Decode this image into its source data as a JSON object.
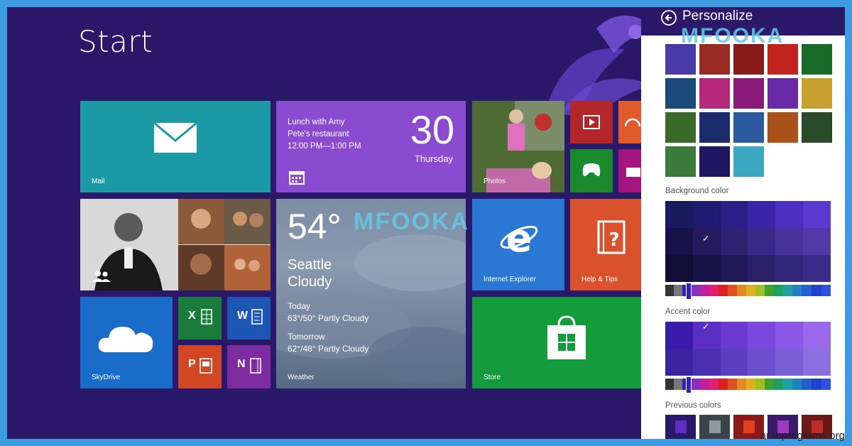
{
  "screen": {
    "title": "Start",
    "watermark": "MFOOKA"
  },
  "tiles": {
    "mail": {
      "label": "Mail"
    },
    "calendar": {
      "line1": "Lunch with Amy",
      "line2": "Pete's restaurant",
      "line3": "12:00 PM—1:00 PM",
      "day": "30",
      "weekday": "Thursday"
    },
    "photos": {
      "label": "Photos"
    },
    "weather": {
      "temp": "54°",
      "city": "Seattle",
      "condition": "Cloudy",
      "today_label": "Today",
      "today_value": "63°/50° Partly Cloudy",
      "tomorrow_label": "Tomorrow",
      "tomorrow_value": "62°/48° Partly Cloudy",
      "label": "Weather"
    },
    "ie": {
      "label": "Internet Explorer"
    },
    "help": {
      "label": "Help & Tips"
    },
    "skydrive": {
      "label": "SkyDrive"
    },
    "excel": {
      "letter": "X"
    },
    "word": {
      "letter": "W"
    },
    "ppt": {
      "letter": "P"
    },
    "onenote": {
      "letter": "N"
    },
    "store": {
      "label": "Store"
    }
  },
  "personalize": {
    "title": "Personalize",
    "watermark": "MFOOKA",
    "background_color_label": "Background color",
    "accent_color_label": "Accent color",
    "previous_colors_label": "Previous colors",
    "background_selected": "#261a5e",
    "accent_selected": "#5b2fc4"
  },
  "footer": {
    "site": "arabprograms.org"
  },
  "colors": {
    "screen_bg": "#2a1868",
    "frame": "#3d9be0"
  }
}
